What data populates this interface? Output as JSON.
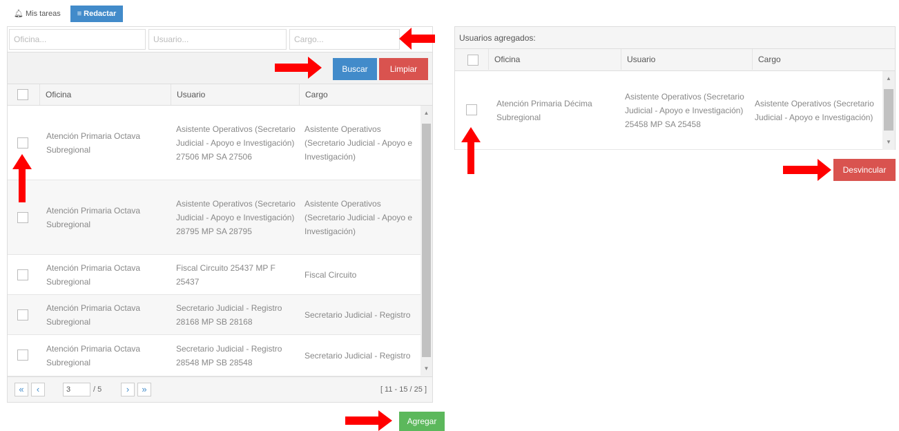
{
  "tabs": [
    {
      "label": "Mis tareas",
      "icon": "bell-icon"
    },
    {
      "label": "Redactar",
      "icon": "menu-icon"
    }
  ],
  "filters": {
    "oficina_placeholder": "Oficina...",
    "usuario_placeholder": "Usuario...",
    "cargo_placeholder": "Cargo..."
  },
  "buttons": {
    "buscar": "Buscar",
    "limpiar": "Limpiar",
    "agregar": "Agregar",
    "desvincular": "Desvincular"
  },
  "colors": {
    "primary": "#428bca",
    "danger": "#d9534f",
    "success": "#5cb85c",
    "arrow": "#ff0000"
  },
  "table": {
    "columns": [
      "Oficina",
      "Usuario",
      "Cargo"
    ],
    "rows": [
      {
        "oficina": "Atención Primaria Octava Subregional",
        "usuario": "Asistente Operativos (Secretario Judicial - Apoyo e Investigación) 27506 MP SA 27506",
        "cargo": "Asistente Operativos (Secretario Judicial - Apoyo e Investigación)"
      },
      {
        "oficina": "Atención Primaria Octava Subregional",
        "usuario": "Asistente Operativos (Secretario Judicial - Apoyo e Investigación) 28795 MP SA 28795",
        "cargo": "Asistente Operativos (Secretario Judicial - Apoyo e Investigación)"
      },
      {
        "oficina": "Atención Primaria Octava Subregional",
        "usuario": "Fiscal Circuito 25437 MP F 25437",
        "cargo": "Fiscal Circuito"
      },
      {
        "oficina": "Atención Primaria Octava Subregional",
        "usuario": "Secretario Judicial - Registro 28168 MP SB 28168",
        "cargo": "Secretario Judicial - Registro"
      },
      {
        "oficina": "Atención Primaria Octava Subregional",
        "usuario": "Secretario Judicial - Registro 28548 MP SB 28548",
        "cargo": "Secretario Judicial - Registro"
      }
    ]
  },
  "pager": {
    "first": "«",
    "prev": "‹",
    "page": "3",
    "total": "/ 5",
    "next": "›",
    "last": "»",
    "range": "[ 11 - 15 / 25 ]"
  },
  "added": {
    "title": "Usuarios agregados:",
    "columns": [
      "Oficina",
      "Usuario",
      "Cargo"
    ],
    "rows": [
      {
        "oficina": "Atención Primaria Décima Subregional",
        "usuario": "Asistente Operativos (Secretario Judicial - Apoyo e Investigación) 25458 MP SA 25458",
        "cargo": "Asistente Operativos (Secretario Judicial - Apoyo e Investigación)"
      }
    ]
  }
}
